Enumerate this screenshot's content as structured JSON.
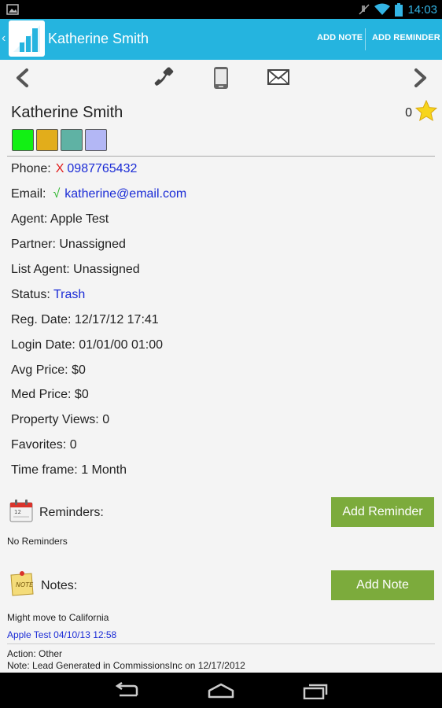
{
  "status_bar": {
    "time": "14:03"
  },
  "action_bar": {
    "title": "Katherine Smith",
    "add_note": "ADD NOTE",
    "add_reminder": "ADD REMINDER"
  },
  "contact": {
    "name": "Katherine Smith",
    "rating": "0",
    "swatch_colors": [
      "#12f014",
      "#e2ad1b",
      "#5fb2a4",
      "#b3b7f5"
    ]
  },
  "details": {
    "phone_label": "Phone:",
    "phone_flag": "X",
    "phone_value": "0987765432",
    "email_label": "Email:",
    "email_flag": "√",
    "email_value": "katherine@email.com",
    "agent": "Agent: Apple Test",
    "partner": "Partner: Unassigned",
    "list_agent": "List Agent: Unassigned",
    "status_label": "Status:",
    "status_value": "Trash",
    "reg_date": "Reg. Date: 12/17/12 17:41",
    "login_date": "Login Date: 01/01/00 01:00",
    "avg_price": "Avg Price: $0",
    "med_price": "Med Price: $0",
    "property_views": "Property Views: 0",
    "favorites": "Favorites: 0",
    "time_frame": "Time frame: 1 Month"
  },
  "reminders": {
    "label": "Reminders:",
    "button": "Add Reminder",
    "empty": "No Reminders"
  },
  "notes": {
    "label": "Notes:",
    "button": "Add Note",
    "items": [
      {
        "text": "Might move to California",
        "author": "Apple Test 04/10/13 12:58"
      },
      {
        "text": "Action: Other",
        "text2": "Note: Lead Generated in CommissionsInc on 12/17/2012"
      }
    ]
  },
  "colors": {
    "action_bar": "#25b4df",
    "accent_button": "#7cab3c",
    "link": "#1a2bd6"
  },
  "icons": [
    "gallery-icon",
    "mute-icon",
    "wifi-icon",
    "battery-icon",
    "back-arrow-icon",
    "phone-icon",
    "mobile-icon",
    "mail-icon",
    "forward-arrow-icon",
    "star-icon",
    "calendar-icon",
    "note-icon",
    "nav-back-icon",
    "nav-home-icon",
    "nav-recents-icon"
  ]
}
